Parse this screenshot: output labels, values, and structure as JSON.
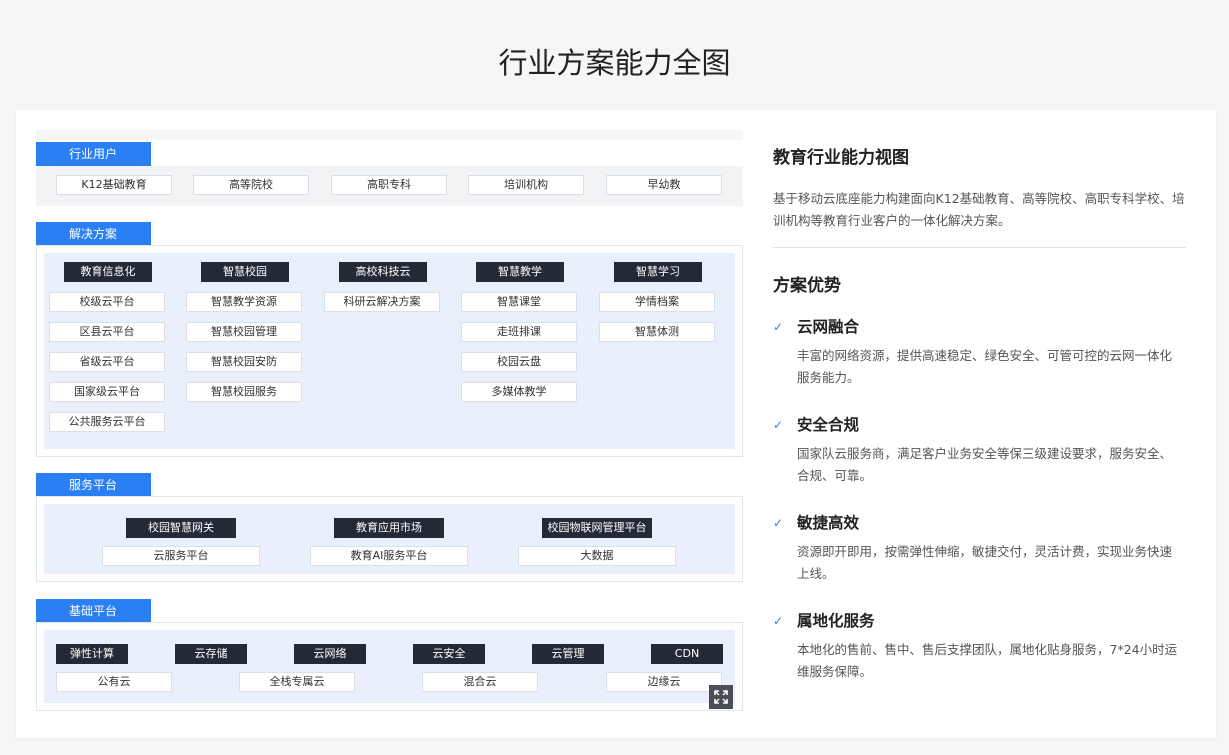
{
  "page_title": "行业方案能力全图",
  "diagram": {
    "industry_users": {
      "label": "行业用户",
      "items": [
        "K12基础教育",
        "高等院校",
        "高职专科",
        "培训机构",
        "早幼教"
      ]
    },
    "solutions": {
      "label": "解决方案",
      "columns": [
        {
          "header": "教育信息化",
          "items": [
            "校级云平台",
            "区县云平台",
            "省级云平台",
            "国家级云平台",
            "公共服务云平台"
          ]
        },
        {
          "header": "智慧校园",
          "items": [
            "智慧教学资源",
            "智慧校园管理",
            "智慧校园安防",
            "智慧校园服务"
          ]
        },
        {
          "header": "高校科技云",
          "items": [
            "科研云解决方案"
          ]
        },
        {
          "header": "智慧教学",
          "items": [
            "智慧课堂",
            "走班排课",
            "校园云盘",
            "多媒体教学"
          ]
        },
        {
          "header": "智慧学习",
          "items": [
            "学情档案",
            "智慧体测"
          ]
        }
      ]
    },
    "service_platform": {
      "label": "服务平台",
      "headers": [
        "校园智慧网关",
        "教育应用市场",
        "校园物联网管理平台"
      ],
      "items": [
        "云服务平台",
        "教育AI服务平台",
        "大数据"
      ]
    },
    "base_platform": {
      "label": "基础平台",
      "headers": [
        "弹性计算",
        "云存储",
        "云网络",
        "云安全",
        "云管理",
        "CDN"
      ],
      "items": [
        "公有云",
        "全栈专属云",
        "混合云",
        "边缘云"
      ]
    },
    "expand_icon": "expand-icon"
  },
  "info": {
    "title": "教育行业能力视图",
    "description": "基于移动云底座能力构建面向K12基础教育、高等院校、高职专科学校、培训机构等教育行业客户的一体化解决方案。",
    "advantages_title": "方案优势",
    "advantages": [
      {
        "name": "云网融合",
        "desc": "丰富的网络资源，提供高速稳定、绿色安全、可管可控的云网一体化服务能力。"
      },
      {
        "name": "安全合规",
        "desc": "国家队云服务商，满足客户业务安全等保三级建设要求，服务安全、合规、可靠。"
      },
      {
        "name": "敏捷高效",
        "desc": "资源即开即用，按需弹性伸缩，敏捷交付，灵活计费，实现业务快速上线。"
      },
      {
        "name": "属地化服务",
        "desc": "本地化的售前、售中、售后支撑团队，属地化贴身服务，7*24小时运维服务保障。"
      }
    ]
  },
  "colors": {
    "accent": "#2a7ff5",
    "dark_chip": "#232a36",
    "inner_panel": "#e9f0fc",
    "page_bg": "#f5f6f8"
  }
}
